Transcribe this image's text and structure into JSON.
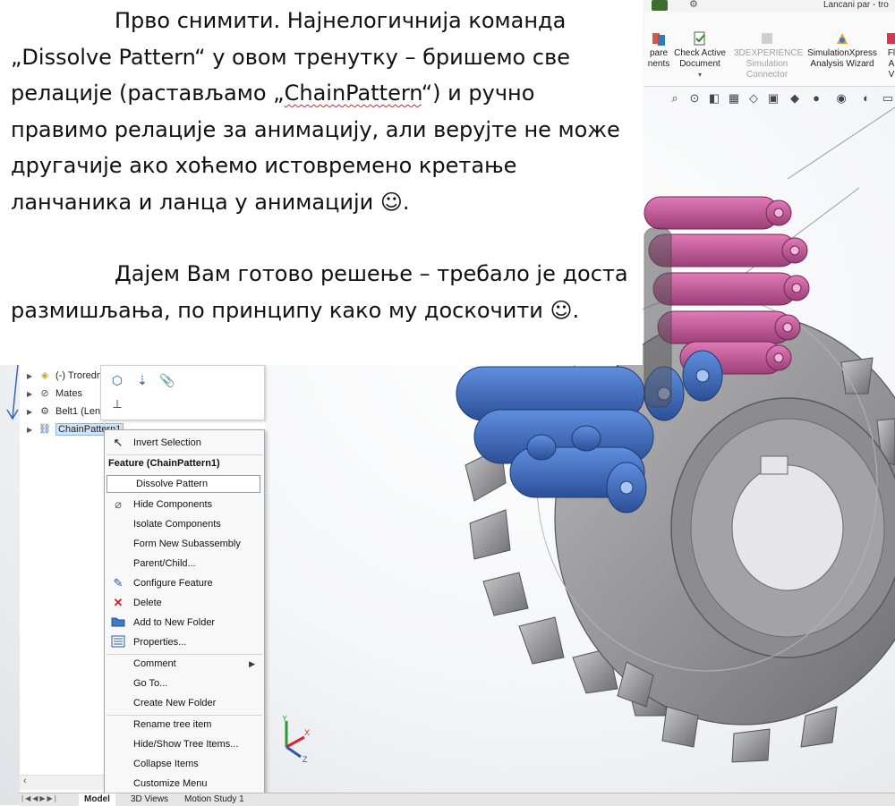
{
  "titlebar": {
    "title": "Lancani par - tro"
  },
  "ribbon": {
    "items": [
      {
        "label": "pare\nnents",
        "icon": "compare-icon",
        "dim": false
      },
      {
        "label": "Check Active\nDocument",
        "icon": "check-document-icon",
        "dim": false
      },
      {
        "label": "3DEXPERIENCE\nSimulation\nConnector",
        "icon": "3dexperience-icon",
        "dim": true
      },
      {
        "label": "SimulationXpress\nAnalysis Wizard",
        "icon": "simulationxpress-icon",
        "dim": false
      },
      {
        "label": "Fl\nA\nV",
        "icon": "flow-icon",
        "dim": false
      }
    ]
  },
  "note": {
    "paragraph1": "Прво снимити. Најнелогичнија команда „Dissolve Pattern“ у овом тренутку – бришемо све релације (растављамо „",
    "paragraph1_word": "ChainPattern",
    "paragraph1_end": "“) и ручно правимо релације за анимацију, али верујте не може другачије ако хоћемо истовремено кретање ланчаника и ланца у анимацији ☺.",
    "paragraph2": "Дајем Вам готово решење – требало је доста размишљања, по принципу како му доскочити ☺."
  },
  "tree": {
    "nodes": [
      {
        "label": "(-) Troredni",
        "icon": "part-icon"
      },
      {
        "label": "Mates",
        "icon": "mates-icon"
      },
      {
        "label": "Belt1 (Len",
        "icon": "belt-icon"
      },
      {
        "label": "ChainPattern1",
        "icon": "chain-pattern-icon",
        "selected": true
      }
    ]
  },
  "menu": {
    "invert_selection": "Invert Selection",
    "header": "Feature (ChainPattern1)",
    "items": [
      "Dissolve Pattern",
      "Hide Components",
      "Isolate Components",
      "Form New Subassembly",
      "Parent/Child...",
      "Configure Feature",
      "Delete",
      "Add to New Folder",
      "Properties...",
      "Comment",
      "Go To...",
      "Create New Folder",
      "Rename tree item",
      "Hide/Show Tree Items...",
      "Collapse Items",
      "Customize Menu"
    ]
  },
  "tabs": {
    "model": "Model",
    "views": "3D Views",
    "motion": "Motion Study 1"
  },
  "colors": {
    "pink": "#c45a9a",
    "blue": "#3f6fc0",
    "steel": "#9a9a9c",
    "accent": "#2a5aa0"
  }
}
